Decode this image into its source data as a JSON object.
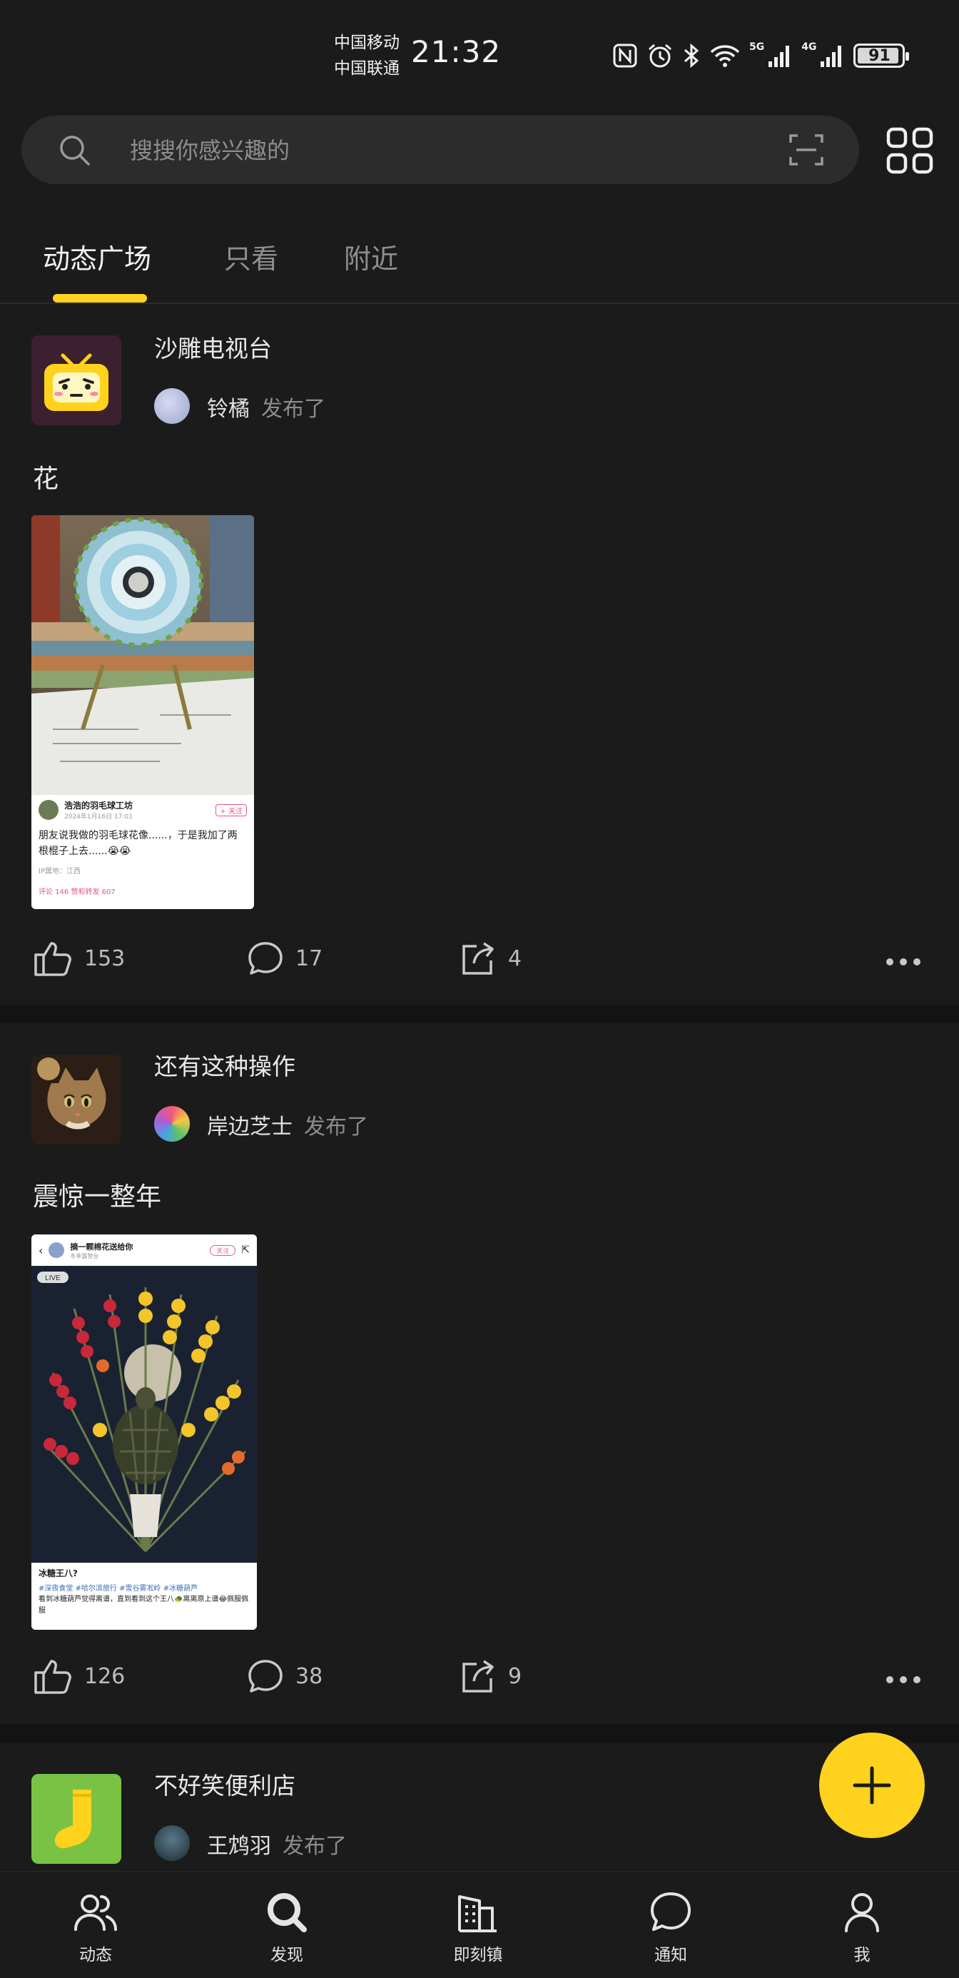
{
  "status_bar": {
    "carrier1": "中国移动",
    "carrier2": "中国联通",
    "time": "21:32",
    "battery": "91",
    "signal1_label": "5G",
    "signal2_label": "4G"
  },
  "search": {
    "placeholder": "搜搜你感兴趣的"
  },
  "tabs": [
    {
      "label": "动态广场",
      "active": true
    },
    {
      "label": "只看",
      "active": false
    },
    {
      "label": "附近",
      "active": false
    }
  ],
  "posts": [
    {
      "channel": "沙雕电视台",
      "user": "铃橘",
      "action": "发布了",
      "title": "花",
      "likes": "153",
      "comments": "17",
      "shares": "4",
      "thumb": {
        "author": "浩浩的羽毛球工坊",
        "date": "2024年1月16日 17:01",
        "follow": "+ 关注",
        "text": "朋友说我做的羽毛球花像......，于是我加了两根棍子上去......😭😭",
        "location": "IP属地：江西",
        "stats": "评论 146    赞和转发 607"
      }
    },
    {
      "channel": "还有这种操作",
      "user": "岸边芝士",
      "action": "发布了",
      "title": "震惊一整年",
      "likes": "126",
      "comments": "38",
      "shares": "9",
      "thumb": {
        "author": "摘一颗棉花送给你",
        "sub": "冬季露营台",
        "follow": "关注",
        "live": "LIVE",
        "caption": "冰糖王八?",
        "tags": "#深夜食堂  #哈尔滨旅行  #雪谷雾凇岭  #冰糖葫芦",
        "text": "看到冰糖葫芦觉得离谱，直到看到这个王八🐢离离原上谱😂佩服佩服"
      }
    },
    {
      "channel": "不好笑便利店",
      "user": "王鸩羽",
      "action": "发布了"
    }
  ],
  "bottom_nav": [
    {
      "label": "动态",
      "icon": "people-icon"
    },
    {
      "label": "发现",
      "icon": "search-icon"
    },
    {
      "label": "即刻镇",
      "icon": "buildings-icon"
    },
    {
      "label": "通知",
      "icon": "chat-bubble-icon"
    },
    {
      "label": "我",
      "icon": "person-icon"
    }
  ],
  "colors": {
    "accent": "#ffd21e",
    "background": "#1b1b1b"
  }
}
